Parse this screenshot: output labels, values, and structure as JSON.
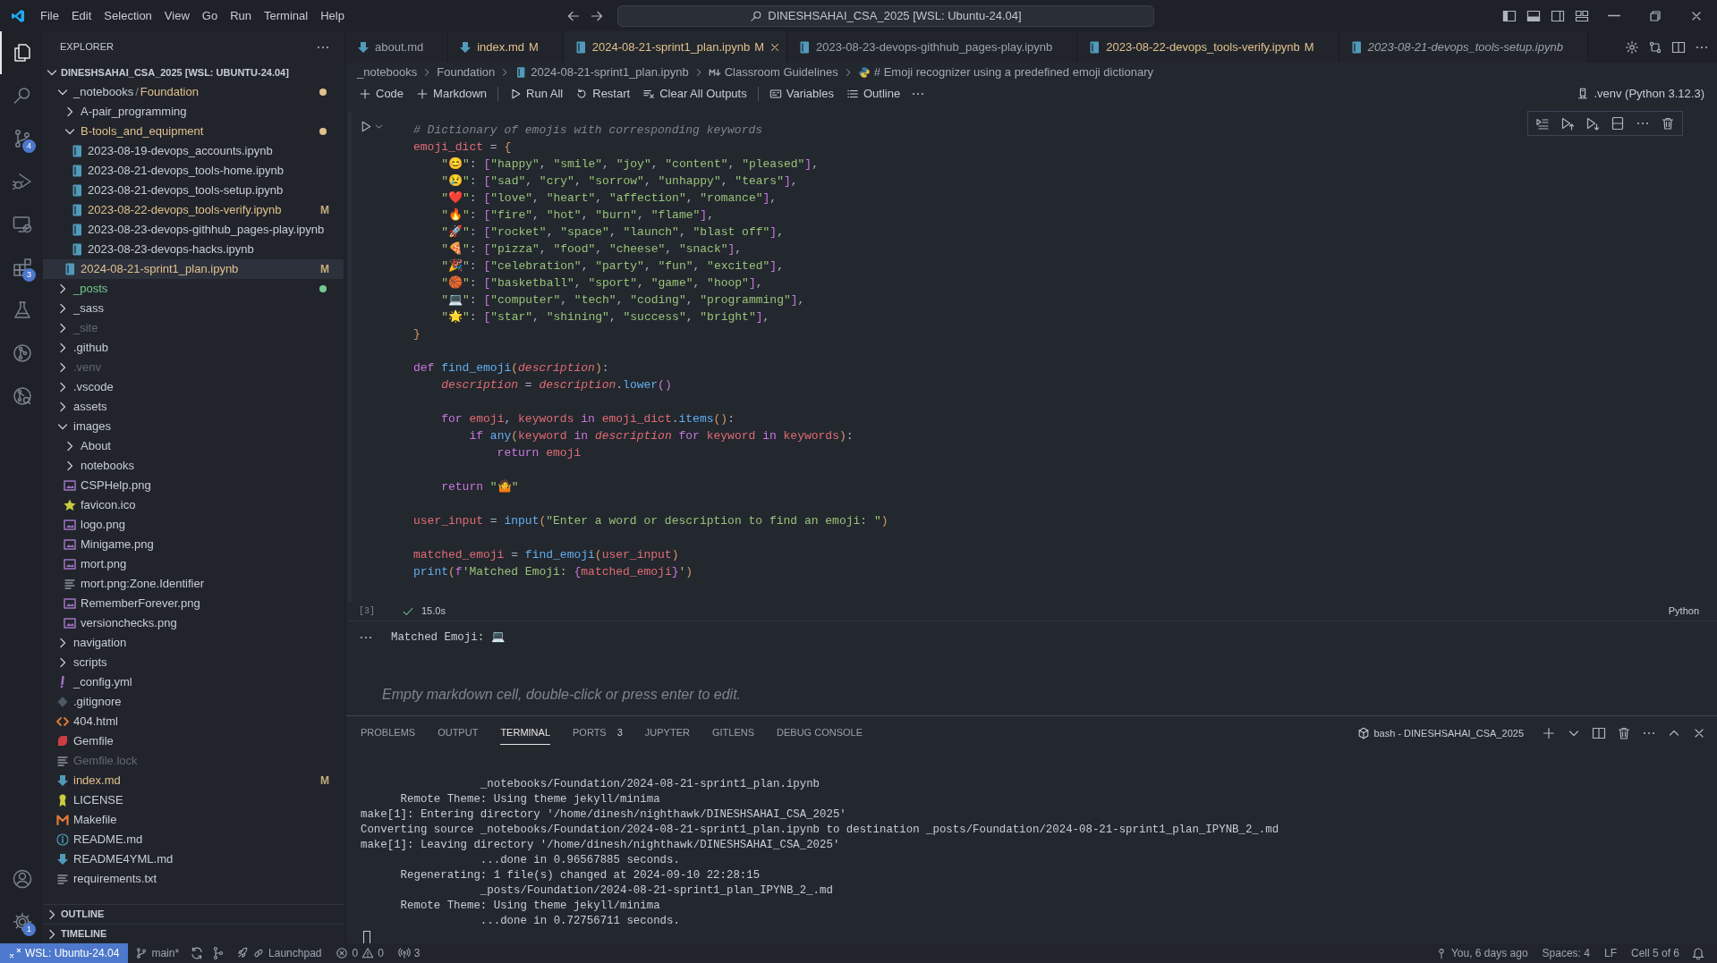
{
  "title_bar": {
    "menu": [
      "File",
      "Edit",
      "Selection",
      "View",
      "Go",
      "Run",
      "Terminal",
      "Help"
    ],
    "search": "DINESHSAHAI_CSA_2025 [WSL: Ubuntu-24.04]"
  },
  "activity_bar": {
    "items": [
      {
        "kind": "files",
        "selected": true
      },
      {
        "kind": "search",
        "selected": false
      },
      {
        "kind": "source-control",
        "selected": false,
        "badge": "4"
      },
      {
        "kind": "run-debug",
        "selected": false
      },
      {
        "kind": "remote",
        "selected": false
      },
      {
        "kind": "extensions",
        "selected": false,
        "badge": "3"
      },
      {
        "kind": "testing",
        "selected": false
      },
      {
        "kind": "git-graph",
        "selected": false
      },
      {
        "kind": "git-inspect",
        "selected": false
      }
    ],
    "bottom": [
      {
        "kind": "account"
      },
      {
        "kind": "settings",
        "badge": "1"
      }
    ]
  },
  "sidebar": {
    "title": "EXPLORER",
    "root": {
      "label": "DINESHSAHAI_CSA_2025 [WSL: UBUNTU-24.04]",
      "expanded": true
    },
    "tree": [
      {
        "label": "_notebooks",
        "separator": "/",
        "compact": "Foundation",
        "kind": "folder",
        "expanded": true,
        "selected": false,
        "color": "#e2c08d",
        "dot": true,
        "children": [
          {
            "label": "A-pair_programming",
            "kind": "folder",
            "expanded": false,
            "selected": false
          },
          {
            "label": "B-tools_and_equipment",
            "kind": "folder",
            "expanded": true,
            "selected": false,
            "color": "#e2c08d",
            "dot": true,
            "children": [
              {
                "label": "2023-08-19-devops_accounts.ipynb",
                "kind": "notebook",
                "selected": false
              },
              {
                "label": "2023-08-21-devops_tools-home.ipynb",
                "kind": "notebook",
                "selected": false
              },
              {
                "label": "2023-08-21-devops_tools-setup.ipynb",
                "kind": "notebook",
                "selected": false
              },
              {
                "label": "2023-08-22-devops_tools-verify.ipynb",
                "kind": "notebook",
                "selected": false,
                "color": "#e2c08d",
                "badge": "M"
              },
              {
                "label": "2023-08-23-devops-githhub_pages-play.ipynb",
                "kind": "notebook",
                "selected": false
              },
              {
                "label": "2023-08-23-devops-hacks.ipynb",
                "kind": "notebook",
                "selected": false
              }
            ]
          },
          {
            "label": "2024-08-21-sprint1_plan.ipynb",
            "kind": "notebook",
            "selected": true,
            "color": "#e2c08d",
            "badge": "M"
          }
        ]
      },
      {
        "label": "_posts",
        "kind": "folder",
        "expanded": false,
        "selected": false,
        "color": "#73c991",
        "dot": true
      },
      {
        "label": "_sass",
        "kind": "folder",
        "expanded": false,
        "selected": false
      },
      {
        "label": "_site",
        "kind": "folder",
        "expanded": false,
        "selected": false,
        "color": "#626874"
      },
      {
        "label": ".github",
        "kind": "folder",
        "expanded": false,
        "selected": false
      },
      {
        "label": ".venv",
        "kind": "folder",
        "expanded": false,
        "selected": false,
        "color": "#626874"
      },
      {
        "label": ".vscode",
        "kind": "folder",
        "expanded": false,
        "selected": false
      },
      {
        "label": "assets",
        "kind": "folder",
        "expanded": false,
        "selected": false
      },
      {
        "label": "images",
        "kind": "folder",
        "expanded": true,
        "selected": false,
        "children": [
          {
            "label": "About",
            "kind": "folder",
            "expanded": false,
            "selected": false
          },
          {
            "label": "notebooks",
            "kind": "folder",
            "expanded": false,
            "selected": false
          },
          {
            "label": "CSPHelp.png",
            "kind": "image",
            "selected": false
          },
          {
            "label": "favicon.ico",
            "kind": "favicon",
            "selected": false
          },
          {
            "label": "logo.png",
            "kind": "image",
            "selected": false
          },
          {
            "label": "Minigame.png",
            "kind": "image",
            "selected": false
          },
          {
            "label": "mort.png",
            "kind": "image",
            "selected": false
          },
          {
            "label": "mort.png:Zone.Identifier",
            "kind": "text",
            "selected": false
          },
          {
            "label": "RememberForever.png",
            "kind": "image",
            "selected": false
          },
          {
            "label": "versionchecks.png",
            "kind": "image",
            "selected": false
          }
        ]
      },
      {
        "label": "navigation",
        "kind": "folder",
        "expanded": false,
        "selected": false
      },
      {
        "label": "scripts",
        "kind": "folder",
        "expanded": false,
        "selected": false
      },
      {
        "label": "_config.yml",
        "kind": "yaml",
        "selected": false
      },
      {
        "label": ".gitignore",
        "kind": "gitignore",
        "selected": false
      },
      {
        "label": "404.html",
        "kind": "html",
        "selected": false
      },
      {
        "label": "Gemfile",
        "kind": "gemfile",
        "selected": false
      },
      {
        "label": "Gemfile.lock",
        "kind": "text",
        "selected": false,
        "color": "#626874"
      },
      {
        "label": "index.md",
        "kind": "markdown",
        "selected": false,
        "color": "#e2c08d",
        "badge": "M"
      },
      {
        "label": "LICENSE",
        "kind": "license",
        "selected": false
      },
      {
        "label": "Makefile",
        "kind": "makefile",
        "selected": false
      },
      {
        "label": "README.md",
        "kind": "readme",
        "selected": false
      },
      {
        "label": "README4YML.md",
        "kind": "markdown",
        "selected": false
      },
      {
        "label": "requirements.txt",
        "kind": "text",
        "selected": false
      }
    ],
    "sections": [
      {
        "label": "OUTLINE",
        "expanded": false
      },
      {
        "label": "TIMELINE",
        "expanded": false
      }
    ]
  },
  "editor": {
    "tabs": [
      {
        "label": "about.md",
        "kind": "markdown",
        "selected": false,
        "modified": false,
        "preview": false
      },
      {
        "label": "index.md",
        "kind": "markdown",
        "selected": false,
        "modified": true,
        "badge": "M",
        "preview": false
      },
      {
        "label": "2024-08-21-sprint1_plan.ipynb",
        "kind": "notebook",
        "selected": true,
        "modified": true,
        "badge": "M",
        "preview": false
      },
      {
        "label": "2023-08-23-devops-githhub_pages-play.ipynb",
        "kind": "notebook",
        "selected": false,
        "modified": false,
        "preview": false
      },
      {
        "label": "2023-08-22-devops_tools-verify.ipynb",
        "kind": "notebook",
        "selected": false,
        "modified": true,
        "badge": "M",
        "preview": false
      },
      {
        "label": "2023-08-21-devops_tools-setup.ipynb",
        "kind": "notebook",
        "selected": false,
        "modified": false,
        "preview": true
      }
    ],
    "breadcrumb": [
      {
        "text": "_notebooks"
      },
      {
        "text": "Foundation"
      },
      {
        "text": "2024-08-21-sprint1_plan.ipynb",
        "kind": "notebook"
      },
      {
        "text": "Classroom Guidelines",
        "kind": "markdown"
      },
      {
        "text": "# Emoji recognizer using a predefined emoji dictionary",
        "kind": "python"
      }
    ],
    "toolbar": {
      "groups": [
        [
          {
            "label": "Code",
            "kind": "add"
          },
          {
            "label": "Markdown",
            "kind": "add"
          }
        ],
        [
          {
            "label": "Run All",
            "kind": "run"
          },
          {
            "label": "Restart",
            "kind": "restart"
          },
          {
            "label": "Clear All Outputs",
            "kind": "clear"
          }
        ],
        [
          {
            "label": "Variables",
            "kind": "variables"
          },
          {
            "label": "Outline",
            "kind": "outline"
          }
        ]
      ],
      "kernel": ".venv (Python 3.12.3)"
    },
    "cell": {
      "execution_count": "[3]",
      "succeeded": true,
      "duration": "15.0s",
      "language": "Python",
      "lines": [
        [
          {
            "kind": "comment",
            "text": "# Dictionary of emojis with corresponding keywords"
          }
        ],
        [
          {
            "kind": "variable",
            "text": "emoji_dict"
          },
          {
            "kind": "punct",
            "text": " = "
          },
          {
            "kind": "bracket1",
            "text": "{"
          }
        ],
        [
          {
            "kind": "string",
            "text": "    \"😊\""
          },
          {
            "kind": "punct",
            "text": ": "
          },
          {
            "kind": "bracket2",
            "text": "["
          },
          {
            "kind": "string",
            "text": "\"happy\""
          },
          {
            "kind": "punct",
            "text": ", "
          },
          {
            "kind": "string",
            "text": "\"smile\""
          },
          {
            "kind": "punct",
            "text": ", "
          },
          {
            "kind": "string",
            "text": "\"joy\""
          },
          {
            "kind": "punct",
            "text": ", "
          },
          {
            "kind": "string",
            "text": "\"content\""
          },
          {
            "kind": "punct",
            "text": ", "
          },
          {
            "kind": "string",
            "text": "\"pleased\""
          },
          {
            "kind": "bracket2",
            "text": "]"
          },
          {
            "kind": "punct",
            "text": ","
          }
        ],
        [
          {
            "kind": "string",
            "text": "    \"😢\""
          },
          {
            "kind": "punct",
            "text": ": "
          },
          {
            "kind": "bracket2",
            "text": "["
          },
          {
            "kind": "string",
            "text": "\"sad\""
          },
          {
            "kind": "punct",
            "text": ", "
          },
          {
            "kind": "string",
            "text": "\"cry\""
          },
          {
            "kind": "punct",
            "text": ", "
          },
          {
            "kind": "string",
            "text": "\"sorrow\""
          },
          {
            "kind": "punct",
            "text": ", "
          },
          {
            "kind": "string",
            "text": "\"unhappy\""
          },
          {
            "kind": "punct",
            "text": ", "
          },
          {
            "kind": "string",
            "text": "\"tears\""
          },
          {
            "kind": "bracket2",
            "text": "]"
          },
          {
            "kind": "punct",
            "text": ","
          }
        ],
        [
          {
            "kind": "string",
            "text": "    \"❤️\""
          },
          {
            "kind": "punct",
            "text": ": "
          },
          {
            "kind": "bracket2",
            "text": "["
          },
          {
            "kind": "string",
            "text": "\"love\""
          },
          {
            "kind": "punct",
            "text": ", "
          },
          {
            "kind": "string",
            "text": "\"heart\""
          },
          {
            "kind": "punct",
            "text": ", "
          },
          {
            "kind": "string",
            "text": "\"affection\""
          },
          {
            "kind": "punct",
            "text": ", "
          },
          {
            "kind": "string",
            "text": "\"romance\""
          },
          {
            "kind": "bracket2",
            "text": "]"
          },
          {
            "kind": "punct",
            "text": ","
          }
        ],
        [
          {
            "kind": "string",
            "text": "    \"🔥\""
          },
          {
            "kind": "punct",
            "text": ": "
          },
          {
            "kind": "bracket2",
            "text": "["
          },
          {
            "kind": "string",
            "text": "\"fire\""
          },
          {
            "kind": "punct",
            "text": ", "
          },
          {
            "kind": "string",
            "text": "\"hot\""
          },
          {
            "kind": "punct",
            "text": ", "
          },
          {
            "kind": "string",
            "text": "\"burn\""
          },
          {
            "kind": "punct",
            "text": ", "
          },
          {
            "kind": "string",
            "text": "\"flame\""
          },
          {
            "kind": "bracket2",
            "text": "]"
          },
          {
            "kind": "punct",
            "text": ","
          }
        ],
        [
          {
            "kind": "string",
            "text": "    \"🚀\""
          },
          {
            "kind": "punct",
            "text": ": "
          },
          {
            "kind": "bracket2",
            "text": "["
          },
          {
            "kind": "string",
            "text": "\"rocket\""
          },
          {
            "kind": "punct",
            "text": ", "
          },
          {
            "kind": "string",
            "text": "\"space\""
          },
          {
            "kind": "punct",
            "text": ", "
          },
          {
            "kind": "string",
            "text": "\"launch\""
          },
          {
            "kind": "punct",
            "text": ", "
          },
          {
            "kind": "string",
            "text": "\"blast off\""
          },
          {
            "kind": "bracket2",
            "text": "]"
          },
          {
            "kind": "punct",
            "text": ","
          }
        ],
        [
          {
            "kind": "string",
            "text": "    \"🍕\""
          },
          {
            "kind": "punct",
            "text": ": "
          },
          {
            "kind": "bracket2",
            "text": "["
          },
          {
            "kind": "string",
            "text": "\"pizza\""
          },
          {
            "kind": "punct",
            "text": ", "
          },
          {
            "kind": "string",
            "text": "\"food\""
          },
          {
            "kind": "punct",
            "text": ", "
          },
          {
            "kind": "string",
            "text": "\"cheese\""
          },
          {
            "kind": "punct",
            "text": ", "
          },
          {
            "kind": "string",
            "text": "\"snack\""
          },
          {
            "kind": "bracket2",
            "text": "]"
          },
          {
            "kind": "punct",
            "text": ","
          }
        ],
        [
          {
            "kind": "string",
            "text": "    \"🎉\""
          },
          {
            "kind": "punct",
            "text": ": "
          },
          {
            "kind": "bracket2",
            "text": "["
          },
          {
            "kind": "string",
            "text": "\"celebration\""
          },
          {
            "kind": "punct",
            "text": ", "
          },
          {
            "kind": "string",
            "text": "\"party\""
          },
          {
            "kind": "punct",
            "text": ", "
          },
          {
            "kind": "string",
            "text": "\"fun\""
          },
          {
            "kind": "punct",
            "text": ", "
          },
          {
            "kind": "string",
            "text": "\"excited\""
          },
          {
            "kind": "bracket2",
            "text": "]"
          },
          {
            "kind": "punct",
            "text": ","
          }
        ],
        [
          {
            "kind": "string",
            "text": "    \"🏀\""
          },
          {
            "kind": "punct",
            "text": ": "
          },
          {
            "kind": "bracket2",
            "text": "["
          },
          {
            "kind": "string",
            "text": "\"basketball\""
          },
          {
            "kind": "punct",
            "text": ", "
          },
          {
            "kind": "string",
            "text": "\"sport\""
          },
          {
            "kind": "punct",
            "text": ", "
          },
          {
            "kind": "string",
            "text": "\"game\""
          },
          {
            "kind": "punct",
            "text": ", "
          },
          {
            "kind": "string",
            "text": "\"hoop\""
          },
          {
            "kind": "bracket2",
            "text": "]"
          },
          {
            "kind": "punct",
            "text": ","
          }
        ],
        [
          {
            "kind": "string",
            "text": "    \"💻\""
          },
          {
            "kind": "punct",
            "text": ": "
          },
          {
            "kind": "bracket2",
            "text": "["
          },
          {
            "kind": "string",
            "text": "\"computer\""
          },
          {
            "kind": "punct",
            "text": ", "
          },
          {
            "kind": "string",
            "text": "\"tech\""
          },
          {
            "kind": "punct",
            "text": ", "
          },
          {
            "kind": "string",
            "text": "\"coding\""
          },
          {
            "kind": "punct",
            "text": ", "
          },
          {
            "kind": "string",
            "text": "\"programming\""
          },
          {
            "kind": "bracket2",
            "text": "]"
          },
          {
            "kind": "punct",
            "text": ","
          }
        ],
        [
          {
            "kind": "string",
            "text": "    \"🌟\""
          },
          {
            "kind": "punct",
            "text": ": "
          },
          {
            "kind": "bracket2",
            "text": "["
          },
          {
            "kind": "string",
            "text": "\"star\""
          },
          {
            "kind": "punct",
            "text": ", "
          },
          {
            "kind": "string",
            "text": "\"shining\""
          },
          {
            "kind": "punct",
            "text": ", "
          },
          {
            "kind": "string",
            "text": "\"success\""
          },
          {
            "kind": "punct",
            "text": ", "
          },
          {
            "kind": "string",
            "text": "\"bright\""
          },
          {
            "kind": "bracket2",
            "text": "]"
          },
          {
            "kind": "punct",
            "text": ","
          }
        ],
        [
          {
            "kind": "bracket1",
            "text": "}"
          }
        ],
        [
          {
            "kind": "keyword",
            "text": "def ",
            "blank_line_before": true
          },
          {
            "kind": "function",
            "text": "find_emoji"
          },
          {
            "kind": "bracket1",
            "text": "("
          },
          {
            "kind": "param",
            "text": "description"
          },
          {
            "kind": "bracket1",
            "text": ")"
          },
          {
            "kind": "punct",
            "text": ":"
          }
        ],
        [
          {
            "kind": "param",
            "text": "    description"
          },
          {
            "kind": "punct",
            "text": " = "
          },
          {
            "kind": "param",
            "text": "description"
          },
          {
            "kind": "punct",
            "text": "."
          },
          {
            "kind": "function",
            "text": "lower"
          },
          {
            "kind": "bracket2",
            "text": "()"
          }
        ],
        [
          {
            "kind": "keyword",
            "text": "    for ",
            "blank_line_before": true
          },
          {
            "kind": "variable",
            "text": "emoji"
          },
          {
            "kind": "punct",
            "text": ", "
          },
          {
            "kind": "variable",
            "text": "keywords"
          },
          {
            "kind": "keyword",
            "text": " in "
          },
          {
            "kind": "variable",
            "text": "emoji_dict"
          },
          {
            "kind": "punct",
            "text": "."
          },
          {
            "kind": "function",
            "text": "items"
          },
          {
            "kind": "bracket1",
            "text": "()"
          },
          {
            "kind": "punct",
            "text": ":"
          }
        ],
        [
          {
            "kind": "keyword",
            "text": "        if "
          },
          {
            "kind": "function",
            "text": "any"
          },
          {
            "kind": "bracket1",
            "text": "("
          },
          {
            "kind": "variable",
            "text": "keyword"
          },
          {
            "kind": "keyword",
            "text": " in "
          },
          {
            "kind": "param",
            "text": "description"
          },
          {
            "kind": "keyword",
            "text": " for "
          },
          {
            "kind": "variable",
            "text": "keyword"
          },
          {
            "kind": "keyword",
            "text": " in "
          },
          {
            "kind": "variable",
            "text": "keywords"
          },
          {
            "kind": "bracket1",
            "text": ")"
          },
          {
            "kind": "punct",
            "text": ":"
          }
        ],
        [
          {
            "kind": "keyword",
            "text": "            return "
          },
          {
            "kind": "variable",
            "text": "emoji"
          }
        ],
        [
          {
            "kind": "keyword",
            "text": "    return ",
            "blank_line_before": true
          },
          {
            "kind": "string",
            "text": "\"🤷\""
          }
        ],
        [
          {
            "kind": "variable",
            "text": "user_input",
            "blank_line_before": true
          },
          {
            "kind": "punct",
            "text": " = "
          },
          {
            "kind": "function",
            "text": "input"
          },
          {
            "kind": "bracket1",
            "text": "("
          },
          {
            "kind": "string",
            "text": "\"Enter a word or description to find an emoji: \""
          },
          {
            "kind": "bracket1",
            "text": ")"
          }
        ],
        [
          {
            "kind": "variable",
            "text": "matched_emoji",
            "blank_line_before": true
          },
          {
            "kind": "punct",
            "text": " = "
          },
          {
            "kind": "function",
            "text": "find_emoji"
          },
          {
            "kind": "bracket1",
            "text": "("
          },
          {
            "kind": "variable",
            "text": "user_input"
          },
          {
            "kind": "bracket1",
            "text": ")"
          }
        ],
        [
          {
            "kind": "function",
            "text": "print"
          },
          {
            "kind": "bracket1",
            "text": "("
          },
          {
            "kind": "keyword",
            "text": "f"
          },
          {
            "kind": "string",
            "text": "'Matched Emoji: "
          },
          {
            "kind": "bracket2",
            "text": "{"
          },
          {
            "kind": "variable",
            "text": "matched_emoji"
          },
          {
            "kind": "bracket2",
            "text": "}"
          },
          {
            "kind": "string",
            "text": "'"
          },
          {
            "kind": "bracket1",
            "text": ")"
          }
        ]
      ]
    },
    "output": {
      "text": "Matched Emoji: 💻"
    },
    "markdown_cell": {
      "placeholder": "Empty markdown cell, double-click or press enter to edit."
    }
  },
  "panel": {
    "tabs": [
      {
        "label": "PROBLEMS",
        "selected": false
      },
      {
        "label": "OUTPUT",
        "selected": false
      },
      {
        "label": "TERMINAL",
        "selected": true
      },
      {
        "label": "PORTS",
        "selected": false,
        "badge": "3"
      },
      {
        "label": "JUPYTER",
        "selected": false
      },
      {
        "label": "GITLENS",
        "selected": false
      },
      {
        "label": "DEBUG CONSOLE",
        "selected": false
      }
    ],
    "terminal_name": "bash - DINESHSAHAI_CSA_2025",
    "lines": [
      "                  _notebooks/Foundation/2024-08-21-sprint1_plan.ipynb",
      "      Remote Theme: Using theme jekyll/minima",
      "make[1]: Entering directory '/home/dinesh/nighthawk/DINESHSAHAI_CSA_2025'",
      "Converting source _notebooks/Foundation/2024-08-21-sprint1_plan.ipynb to destination _posts/Foundation/2024-08-21-sprint1_plan_IPYNB_2_.md",
      "make[1]: Leaving directory '/home/dinesh/nighthawk/DINESHSAHAI_CSA_2025'",
      "                  ...done in 0.96567885 seconds.",
      "      Regenerating: 1 file(s) changed at 2024-09-10 22:28:15",
      "                  _posts/Foundation/2024-08-21-sprint1_plan_IPYNB_2_.md",
      "      Remote Theme: Using theme jekyll/minima",
      "                  ...done in 0.72756711 seconds."
    ]
  },
  "status_bar": {
    "remote": "WSL: Ubuntu-24.04",
    "branch": "main*",
    "launchpad": "Launchpad",
    "errors": "0",
    "warnings": "0",
    "ports": "3",
    "blame": "You, 6 days ago",
    "indent": "Spaces: 4",
    "eol": "LF",
    "cell_position": "Cell 5 of 6"
  }
}
